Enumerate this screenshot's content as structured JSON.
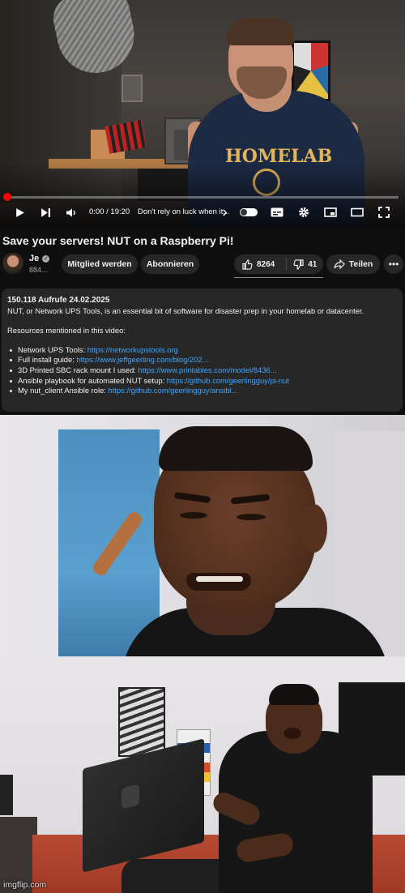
{
  "player": {
    "time": "0:00 / 19:20",
    "chapter": "Don't rely on luck when it...",
    "progress_fraction": 0.0,
    "shirt_text": "HOMELAB",
    "icons": [
      "play-icon",
      "next-icon",
      "volume-icon",
      "chevron-right-icon",
      "autoplay-toggle",
      "subtitles-icon",
      "settings-icon",
      "miniplayer-icon",
      "theater-icon",
      "fullscreen-icon"
    ]
  },
  "video": {
    "title": "Save your servers! NUT on a Raspberry Pi!",
    "channel_name": "Je",
    "subscribers": "884...",
    "join_label": "Mitglied werden",
    "subscribe_label": "Abonnieren",
    "likes": "8264",
    "dislikes": "41",
    "share_label": "Teilen",
    "more_label": "•••"
  },
  "description": {
    "meta": "150.118 Aufrufe  24.02.2025",
    "summary": "NUT, or Network UPS Tools, is an essential bit of software for disaster prep in your homelab or datacenter.",
    "resources_heading": "Resources mentioned in this video:",
    "links": [
      {
        "label": "Network UPS Tools: ",
        "url": "https://networkupstools.org"
      },
      {
        "label": "Full install guide: ",
        "url": "https://www.jeffgeerling.com/blog/202..."
      },
      {
        "label": "3D Printed SBC rack mount I used: ",
        "url": "https://www.printables.com/model/8436..."
      },
      {
        "label": "Ansible playbook for automated NUT setup: ",
        "url": "https://github.com/geerlingguy/pi-nut"
      },
      {
        "label": "My nut_client Ansible role: ",
        "url": "https://github.com/geerlingguy/ansibl..."
      }
    ]
  },
  "watermark": "imgflip.com",
  "colors": {
    "background": "#0f0f0f",
    "chip": "#272727",
    "link": "#3ea6ff",
    "progress": "#ff0000"
  }
}
